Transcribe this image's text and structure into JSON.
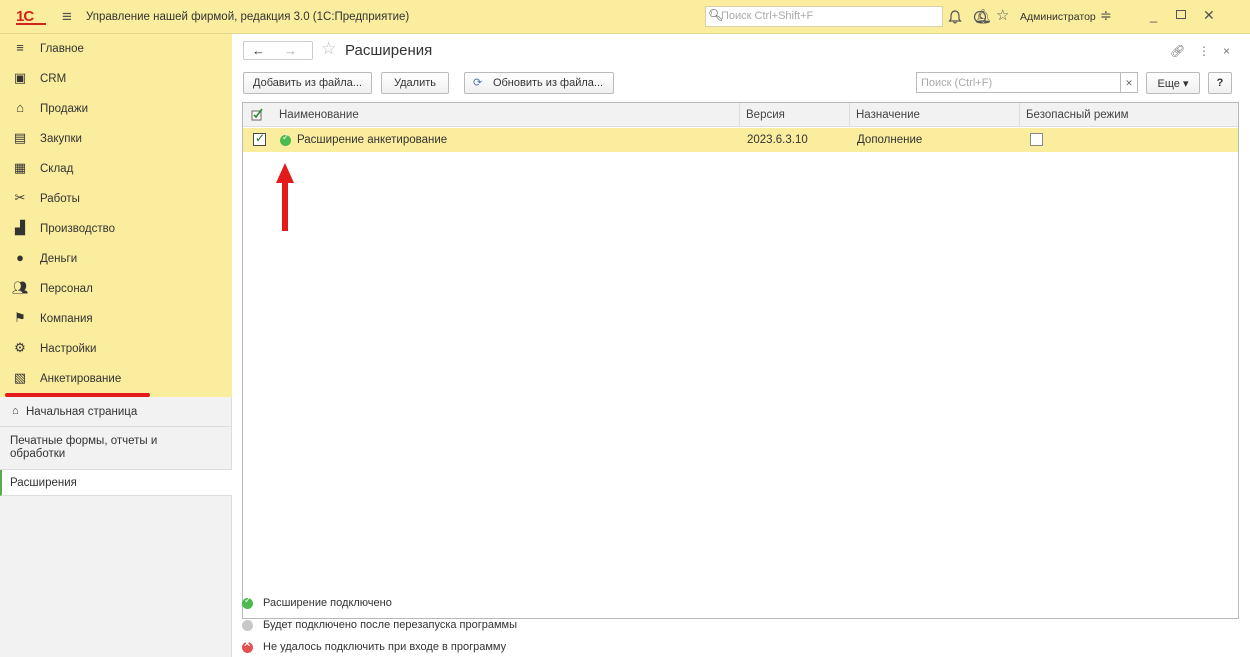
{
  "titlebar": {
    "logo": "1С",
    "app_title": "Управление нашей фирмой, редакция 3.0  (1С:Предприятие)",
    "search_placeholder": "Поиск Ctrl+Shift+F",
    "user": "Администратор"
  },
  "sidebar": {
    "sections": [
      {
        "label": "Главное",
        "icon": "menu-icon"
      },
      {
        "label": "CRM",
        "icon": "crm-icon"
      },
      {
        "label": "Продажи",
        "icon": "sales-icon"
      },
      {
        "label": "Закупки",
        "icon": "purchases-icon"
      },
      {
        "label": "Склад",
        "icon": "warehouse-icon"
      },
      {
        "label": "Работы",
        "icon": "tools-icon"
      },
      {
        "label": "Производство",
        "icon": "factory-icon"
      },
      {
        "label": "Деньги",
        "icon": "money-icon"
      },
      {
        "label": "Персонал",
        "icon": "staff-icon"
      },
      {
        "label": "Компания",
        "icon": "flag-icon"
      },
      {
        "label": "Настройки",
        "icon": "gear-icon"
      },
      {
        "label": "Анкетирование",
        "icon": "survey-icon"
      }
    ],
    "nav": {
      "home": "Начальная страница",
      "print": "Печатные формы, отчеты и обработки",
      "extensions": "Расширения"
    }
  },
  "main": {
    "title": "Расширения",
    "buttons": {
      "add": "Добавить из файла...",
      "delete": "Удалить",
      "update": "Обновить из файла...",
      "more": "Еще",
      "help": "?"
    },
    "search_placeholder": "Поиск (Ctrl+F)",
    "table": {
      "columns": [
        "Наименование",
        "Версия",
        "Назначение",
        "Безопасный режим"
      ],
      "rows": [
        {
          "name": "Расширение анкетирование",
          "version": "2023.6.3.10",
          "purpose": "Дополнение",
          "active": true,
          "safe_mode": false
        }
      ]
    },
    "legend": [
      {
        "label": "Расширение подключено",
        "status": "green"
      },
      {
        "label": "Будет подключено после перезапуска программы",
        "status": "gray"
      },
      {
        "label": "Не удалось подключить при входе в программу",
        "status": "red"
      }
    ]
  },
  "colors": {
    "accent_yellow": "#fbed9e",
    "annotation_red": "#e31b1b",
    "ok_green": "#4cba4c"
  }
}
